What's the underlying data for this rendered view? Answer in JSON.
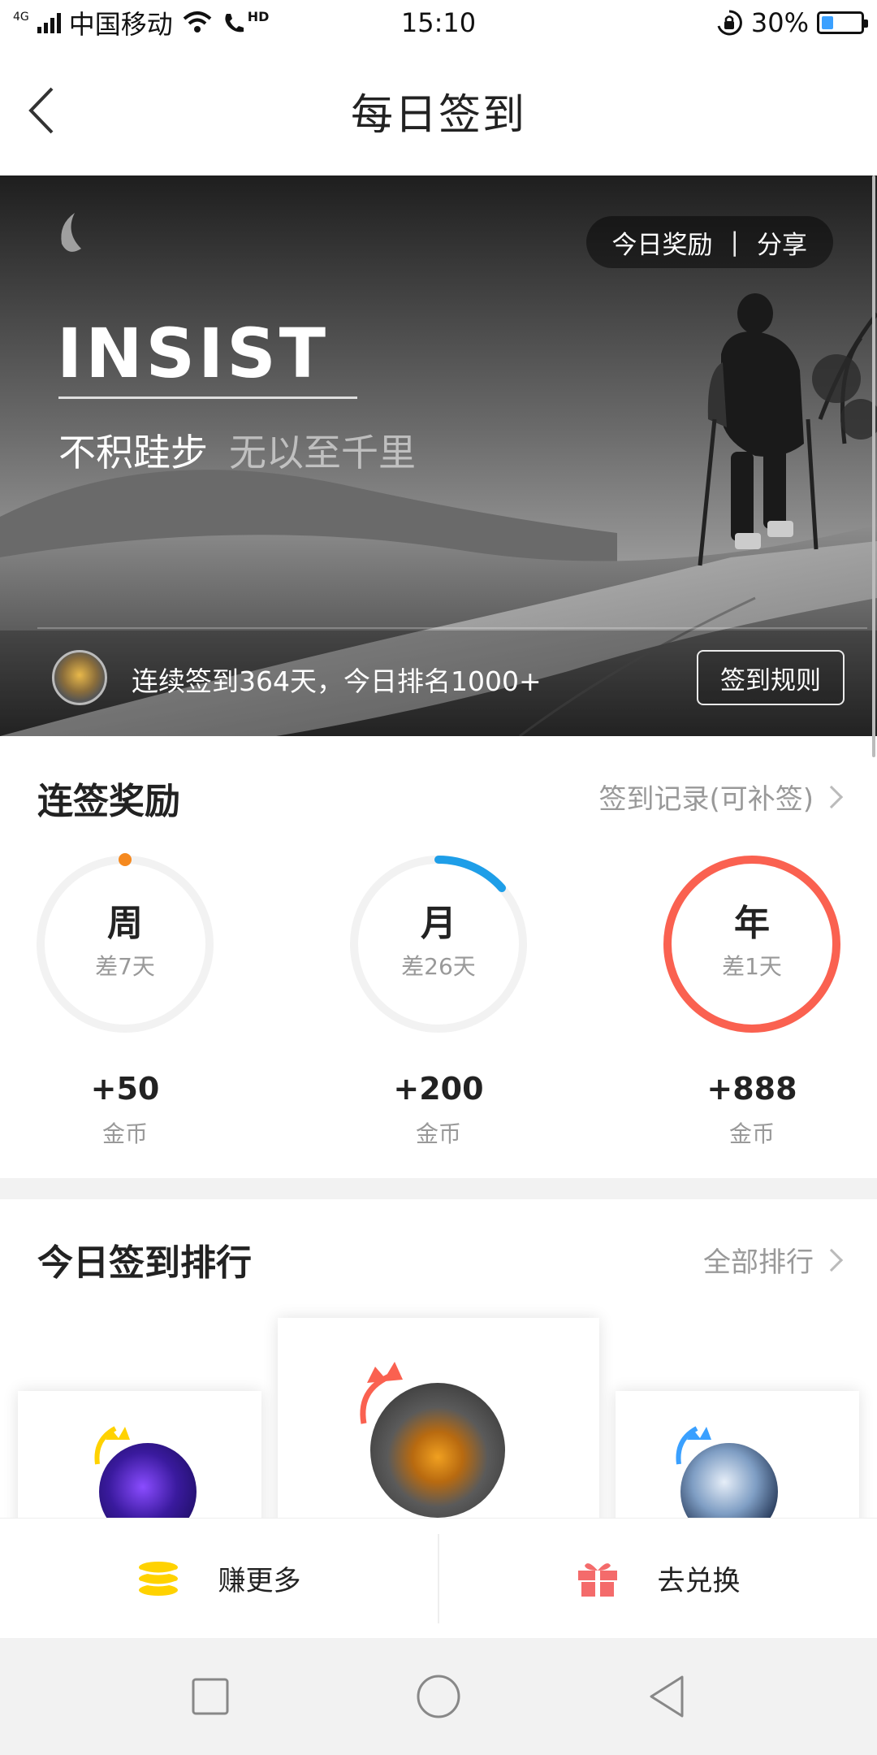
{
  "status_bar": {
    "network_type": "4G",
    "carrier": "中国移动",
    "hd_badge": "HD",
    "time": "15:10",
    "battery_percent": "30%",
    "battery_level": 0.3
  },
  "header": {
    "title": "每日签到"
  },
  "hero": {
    "reward_label": "今日奖励",
    "separator": "|",
    "share_label": "分享",
    "headline": "INSIST",
    "slogan_bold": "不积跬步",
    "slogan_light": "无以至千里",
    "streak_text": "连续签到364天，今日排名1000+",
    "rules_button": "签到规则"
  },
  "streak_rewards": {
    "title": "连签奖励",
    "record_link": "签到记录(可补签)",
    "items": [
      {
        "period": "周",
        "remaining": "差7天",
        "amount": "+50",
        "unit": "金币",
        "progress": 0.0,
        "color": "#f5891f"
      },
      {
        "period": "月",
        "remaining": "差26天",
        "amount": "+200",
        "unit": "金币",
        "progress": 0.13,
        "color": "#1e9ee8"
      },
      {
        "period": "年",
        "remaining": "差1天",
        "amount": "+888",
        "unit": "金币",
        "progress": 1.0,
        "color": "#fa6150"
      }
    ]
  },
  "ranking": {
    "title": "今日签到排行",
    "all_link": "全部排行"
  },
  "actions": {
    "earn_more": "赚更多",
    "redeem": "去兑换"
  },
  "colors": {
    "accent_red": "#fa6150",
    "coin_yellow": "#ffd200",
    "gift_red": "#f46b6b",
    "text_gray": "#999999"
  }
}
